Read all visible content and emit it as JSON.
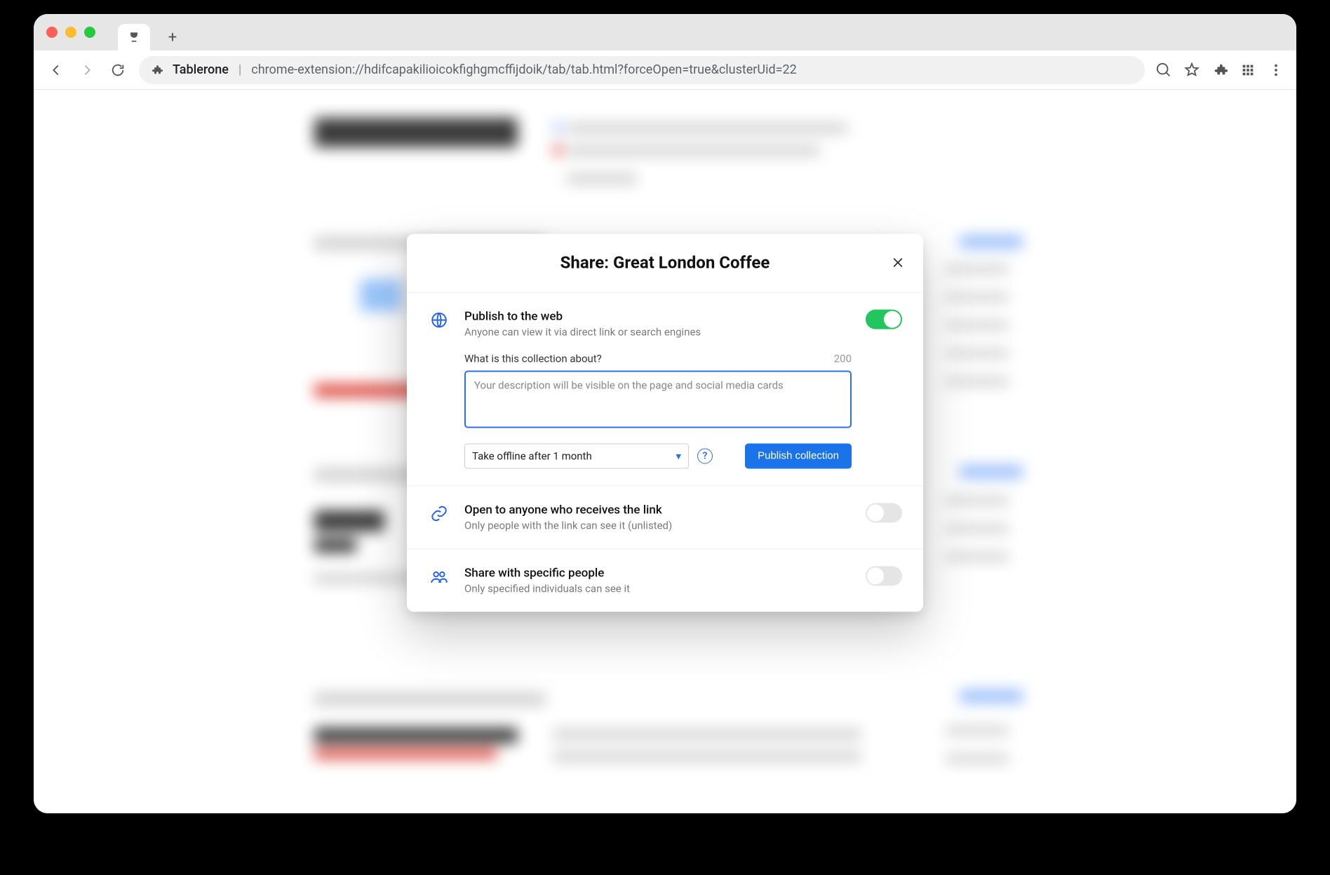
{
  "browser": {
    "extension_name": "Tablerone",
    "url": "chrome-extension://hdifcapakilioicokfighgmcffijdoik/tab/tab.html?forceOpen=true&clusterUid=22"
  },
  "modal": {
    "title": "Share: Great London Coffee",
    "publish": {
      "heading": "Publish to the web",
      "sub": "Anyone can view it via direct link or search engines",
      "enabled": true,
      "desc_label": "What is this collection about?",
      "desc_count": "200",
      "desc_placeholder": "Your description will be visible on the page and social media cards",
      "offline_select": "Take offline after 1 month",
      "publish_button": "Publish collection"
    },
    "link": {
      "heading": "Open to anyone who receives the link",
      "sub": "Only people with the link can see it (unlisted)",
      "enabled": false
    },
    "people": {
      "heading": "Share with specific people",
      "sub": "Only specified individuals can see it",
      "enabled": false
    }
  }
}
